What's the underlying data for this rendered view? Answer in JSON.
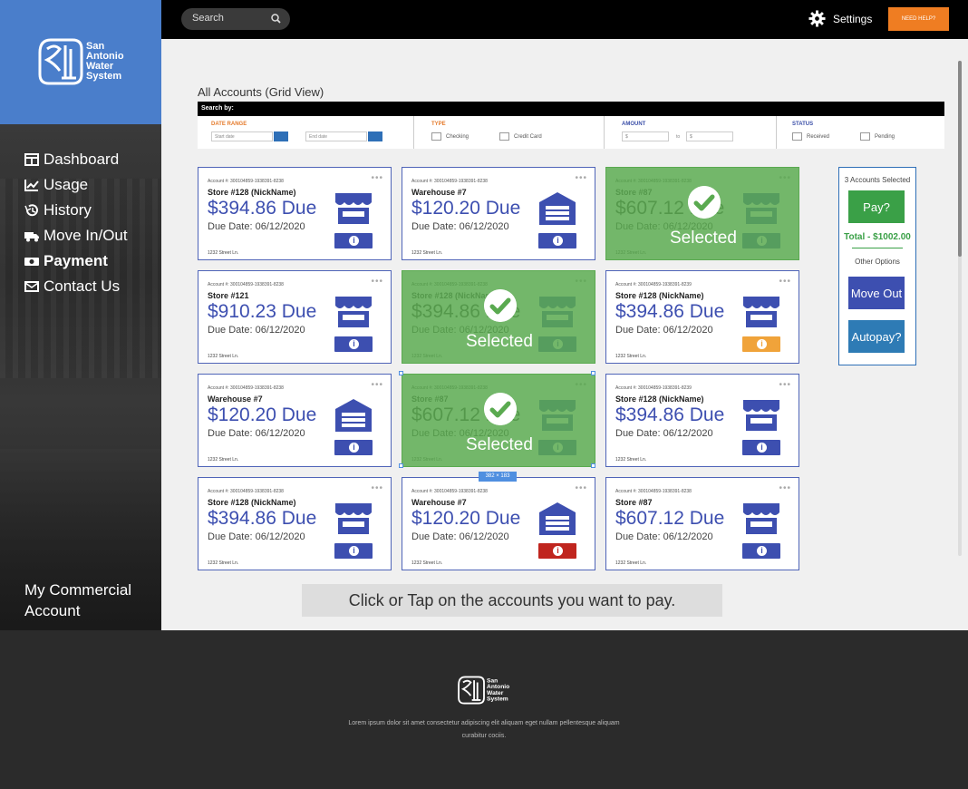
{
  "brand": {
    "logo_text": "San Antonio Water System"
  },
  "topbar": {
    "search_placeholder": "Search",
    "settings_label": "Settings",
    "help_label": "NEED HELP?"
  },
  "nav": {
    "items": [
      {
        "label": "Dashboard",
        "icon": "dashboard-icon"
      },
      {
        "label": "Usage",
        "icon": "chart-icon"
      },
      {
        "label": "History",
        "icon": "history-icon"
      },
      {
        "label": "Move In/Out",
        "icon": "truck-icon"
      },
      {
        "label": "Payment",
        "icon": "money-icon",
        "active": true
      },
      {
        "label": "Contact Us",
        "icon": "mail-icon"
      }
    ],
    "commercial_label": "My Commercial Account"
  },
  "page": {
    "title": "All Accounts (Grid View)",
    "search_by": "Search by:"
  },
  "filters": {
    "date_range": {
      "label": "DATE RANGE",
      "start_placeholder": "Start date",
      "end_placeholder": "End date"
    },
    "type": {
      "label": "TYPE",
      "options": [
        "Checking",
        "Credit Card"
      ]
    },
    "amount": {
      "label": "AMOUNT",
      "from_placeholder": "$",
      "to_label": "to",
      "to_placeholder": "$"
    },
    "status": {
      "label": "STATUS",
      "options": [
        "Received",
        "Pending"
      ]
    }
  },
  "cards": [
    {
      "acct": "Account #: 300104859-1938391-8238",
      "name": "Store #128 (NickName)",
      "amount": "$394.86 Due",
      "due": "Due Date: 06/12/2020",
      "street": "1232 Street Ln.",
      "icon": "store-icon",
      "info": "blue",
      "selected": false
    },
    {
      "acct": "Account #: 300104859-1938391-8238",
      "name": "Warehouse #7",
      "amount": "$120.20 Due",
      "due": "Due Date: 06/12/2020",
      "street": "1232 Street Ln.",
      "icon": "warehouse-icon",
      "info": "blue",
      "selected": false
    },
    {
      "acct": "Account #: 300104859-1938391-8238",
      "name": "Store #87",
      "amount": "$607.12 Due",
      "due": "Due Date: 06/12/2020",
      "street": "1232 Street Ln.",
      "icon": "store-icon",
      "info": "blue",
      "selected": true
    },
    {
      "acct": "Account #: 300104859-1938391-8238",
      "name": "Store #121",
      "amount": "$910.23 Due",
      "due": "Due Date: 06/12/2020",
      "street": "1232 Street Ln.",
      "icon": "store-icon",
      "info": "blue",
      "selected": false
    },
    {
      "acct": "Account #: 300104859-1938391-8238",
      "name": "Store #128 (NickName)",
      "amount": "$394.86 Due",
      "due": "Due Date: 06/12/2020",
      "street": "1232 Street Ln.",
      "icon": "store-icon",
      "info": "blue",
      "selected": true
    },
    {
      "acct": "Account #: 300104859-1938391-8239",
      "name": "Store #128 (NickName)",
      "amount": "$394.86 Due",
      "due": "Due Date: 06/12/2020",
      "street": "1232 Street Ln.",
      "icon": "store-icon",
      "info": "orange",
      "selected": false
    },
    {
      "acct": "Account #: 300104859-1938391-8238",
      "name": "Warehouse #7",
      "amount": "$120.20 Due",
      "due": "Due Date: 06/12/2020",
      "street": "1232 Street Ln.",
      "icon": "warehouse-icon",
      "info": "blue",
      "selected": false
    },
    {
      "acct": "Account #: 300104859-1938391-8238",
      "name": "Store #87",
      "amount": "$607.12 Due",
      "due": "Due Date: 06/12/2020",
      "street": "1232 Street Ln.",
      "icon": "store-icon",
      "info": "blue",
      "selected": true
    },
    {
      "acct": "Account #: 300104859-1938391-8239",
      "name": "Store #128 (NickName)",
      "amount": "$394.86 Due",
      "due": "Due Date: 06/12/2020",
      "street": "1232 Street Ln.",
      "icon": "store-icon",
      "info": "blue",
      "selected": false
    },
    {
      "acct": "Account #: 300104859-1938391-8238",
      "name": "Store #128 (NickName)",
      "amount": "$394.86 Due",
      "due": "Due Date: 06/12/2020",
      "street": "1232 Street Ln.",
      "icon": "store-icon",
      "info": "blue",
      "selected": false
    },
    {
      "acct": "Account #: 300104859-1938391-8238",
      "name": "Warehouse #7",
      "amount": "$120.20 Due",
      "due": "Due Date: 06/12/2020",
      "street": "1232 Street Ln.",
      "icon": "warehouse-icon",
      "info": "red",
      "selected": false
    },
    {
      "acct": "Account #: 300104859-1938391-8238",
      "name": "Store #87",
      "amount": "$607.12 Due",
      "due": "Due Date: 06/12/2020",
      "street": "1232 Street Ln.",
      "icon": "store-icon",
      "info": "blue",
      "selected": false
    }
  ],
  "selected_label": "Selected",
  "selection_size_tag": "382 × 183",
  "pay_panel": {
    "count": "3 Accounts Selected",
    "pay_label": "Pay?",
    "total": "Total - $1002.00",
    "other_options": "Other Options",
    "move_out": "Move Out",
    "autopay": "Autopay?"
  },
  "hint": "Click or Tap on the accounts you want to pay.",
  "footer": {
    "text": "Lorem ipsum dolor sit amet consectetur adipiscing elit aliquam eget nullam pellentesque aliquam curabitur cociis."
  },
  "colors": {
    "brand_blue": "#4a7ecb",
    "accent_orange": "#ef7d22",
    "card_blue": "#3d4fb0",
    "selected_green": "#5aaa50",
    "pay_green": "#3aa047"
  }
}
